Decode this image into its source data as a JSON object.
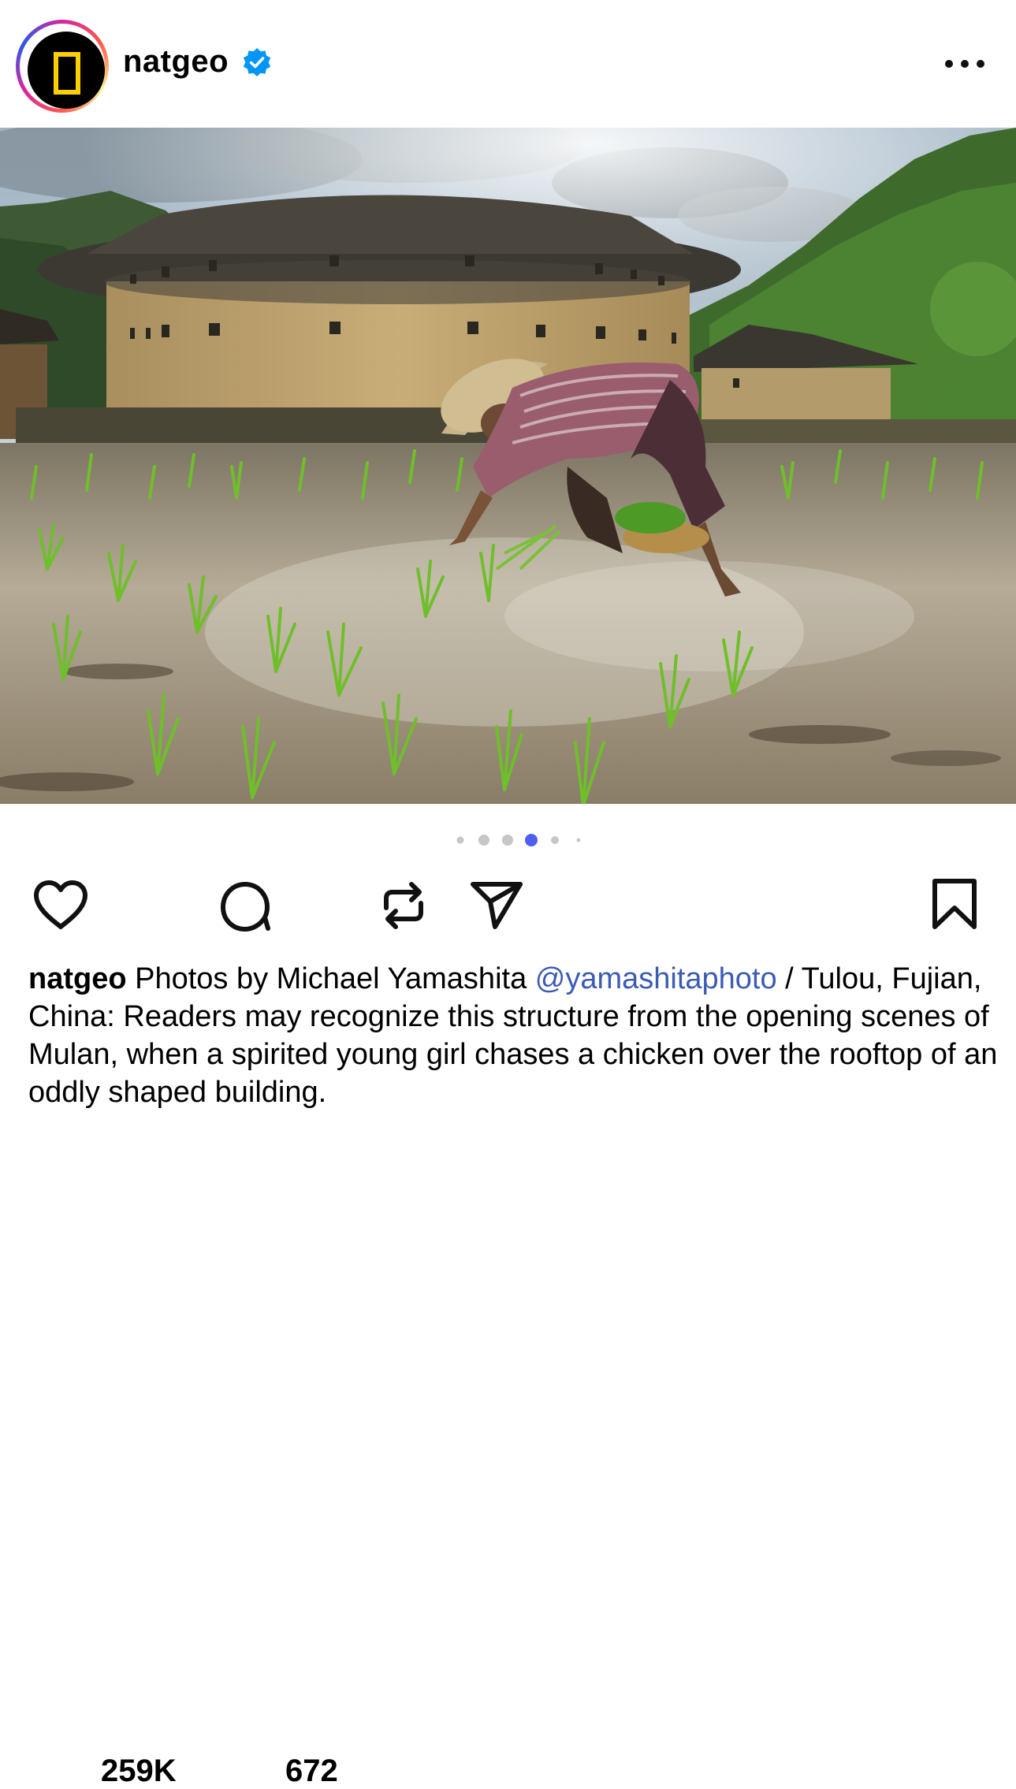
{
  "post": {
    "username": "natgeo",
    "verified_icon": "verified-badge-icon",
    "more_icon": "more-options-icon",
    "avatar_icon": "natgeo-logo"
  },
  "carousel": {
    "slide_count": 6,
    "active_index": 3,
    "active_color": "#4f5ef0",
    "inactive_color": "#c7c7c7"
  },
  "actions": {
    "likes": "259K",
    "comments": "672",
    "like_icon": "heart-icon",
    "comment_icon": "comment-icon",
    "repost_icon": "repost-icon",
    "share_icon": "share-icon",
    "save_icon": "bookmark-icon"
  },
  "caption": {
    "username": "natgeo",
    "text_before_mention": " Photos by Michael Yamashita ",
    "mention": "@yamashitaphoto",
    "text_after_mention": " / Tulou, Fujian, China: Readers may recognize this structure from the opening scenes of Mulan, when a spirited young girl chases a chicken over the rooftop of an oddly shaped building.",
    "mention_color": "#3b5bb5"
  }
}
